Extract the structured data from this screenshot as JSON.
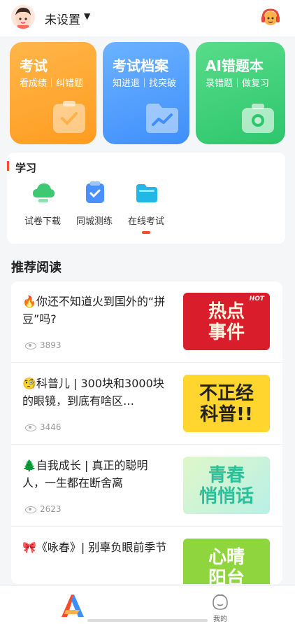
{
  "header": {
    "user_name": "未设置"
  },
  "cards": [
    {
      "title": "考试",
      "subtitle": "看成绩｜纠错题"
    },
    {
      "title": "考试档案",
      "subtitle": "知进退｜找突破"
    },
    {
      "title": "AI错题本",
      "subtitle": "录错题｜做复习"
    }
  ],
  "study": {
    "title": "学习",
    "tools": [
      {
        "label": "试卷下载"
      },
      {
        "label": "同城测练"
      },
      {
        "label": "在线考试"
      }
    ]
  },
  "recommend": {
    "title": "推荐阅读",
    "articles": [
      {
        "title": "🔥你还不知道火到国外的“拼豆”吗?",
        "views": "3893",
        "thumb_text": "热点\n事件",
        "thumb_badge": "HOT"
      },
      {
        "title": "🧐科普儿 | 300块和3000块的眼镜，到底有啥区…",
        "views": "3446",
        "thumb_text": "不正经\n科普!!"
      },
      {
        "title": "🌲自我成长 | 真正的聪明人，一生都在断舍离",
        "views": "2623",
        "thumb_text": "青春\n悄悄话"
      },
      {
        "title": "🎀《咏春》| 别辜负眼前季节",
        "views": "",
        "thumb_text": "心晴\n阳台"
      }
    ]
  },
  "tabbar": {
    "mine_label": "我的"
  },
  "colors": {
    "accent": "#ff4a2b",
    "orange": "#ff9c1f",
    "blue": "#3e8ffc",
    "green": "#2dc66b"
  }
}
